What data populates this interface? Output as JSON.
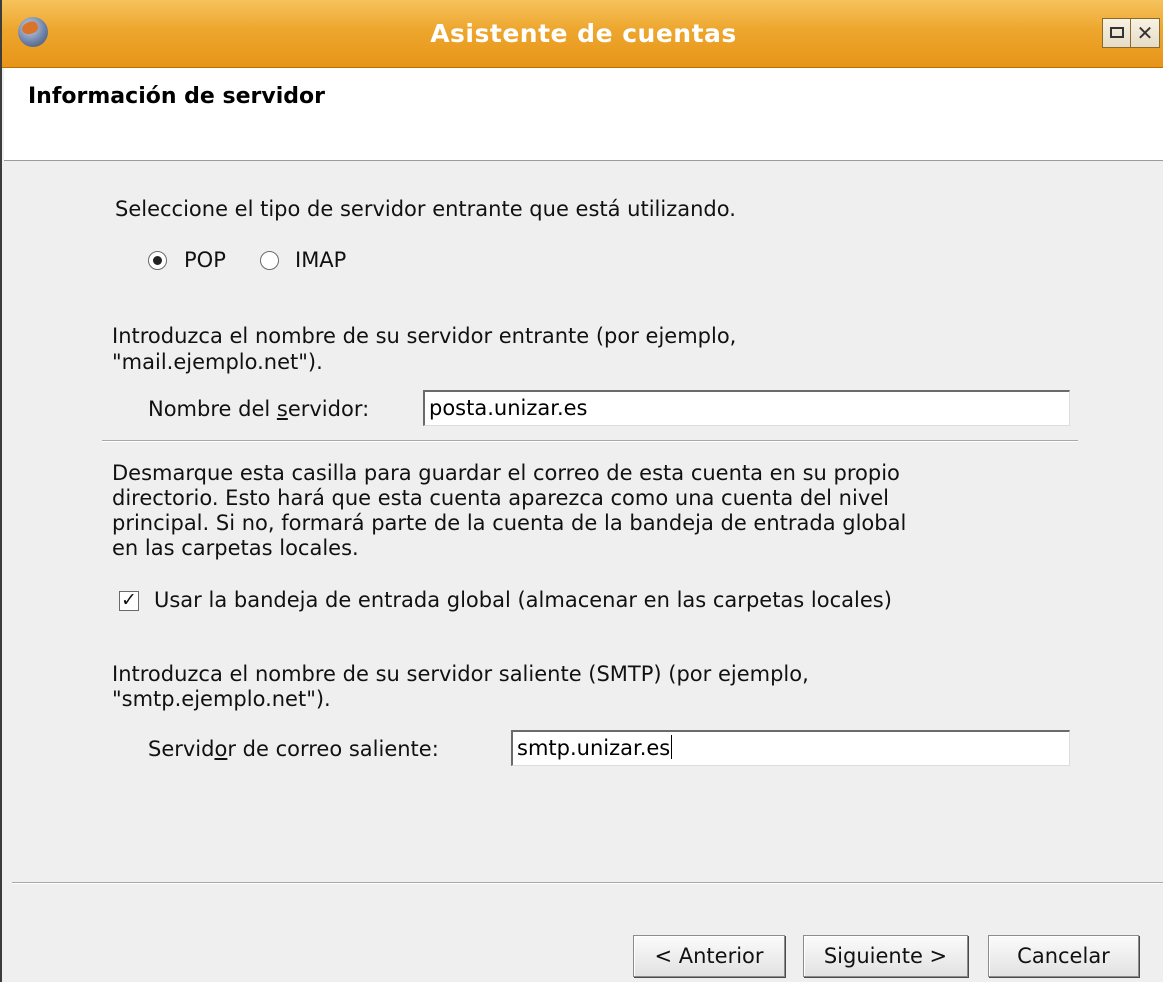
{
  "window": {
    "title": "Asistente de cuentas",
    "icon": "thunderbird-icon",
    "controls": [
      "maximize-icon",
      "close-icon"
    ],
    "title_bar_color": "#eda62d"
  },
  "page": {
    "heading": "Información de servidor"
  },
  "incoming": {
    "prompt": "Seleccione el tipo de servidor entrante que está utilizando.",
    "options": [
      {
        "label": "POP",
        "checked": true
      },
      {
        "label": "IMAP",
        "checked": false
      }
    ],
    "help_line1": "Introduzca el nombre de su servidor entrante (por ejemplo,",
    "help_line2": "\"mail.ejemplo.net\").",
    "label_before": "Nombre del ",
    "label_mnemonic": "s",
    "label_after": "ervidor:",
    "value": "posta.unizar.es"
  },
  "global_inbox": {
    "description_lines": [
      "Desmarque esta casilla para guardar el correo de esta cuenta en su propio",
      "directorio. Esto hará que esta cuenta aparezca como una cuenta del nivel",
      "principal. Si no, formará parte de la cuenta de la bandeja de entrada global",
      "en las carpetas locales."
    ],
    "checkbox_label": "Usar la bandeja de entrada global (almacenar en las carpetas locales)",
    "checked": true
  },
  "outgoing": {
    "help_line1": "Introduzca el nombre de su servidor saliente (SMTP) (por ejemplo,",
    "help_line2": "\"smtp.ejemplo.net\").",
    "label_before": "Servid",
    "label_mnemonic": "o",
    "label_after": "r de correo saliente:",
    "value": "smtp.unizar.es"
  },
  "buttons": {
    "back": "< Anterior",
    "next": "Siguiente >",
    "cancel": "Cancelar"
  }
}
